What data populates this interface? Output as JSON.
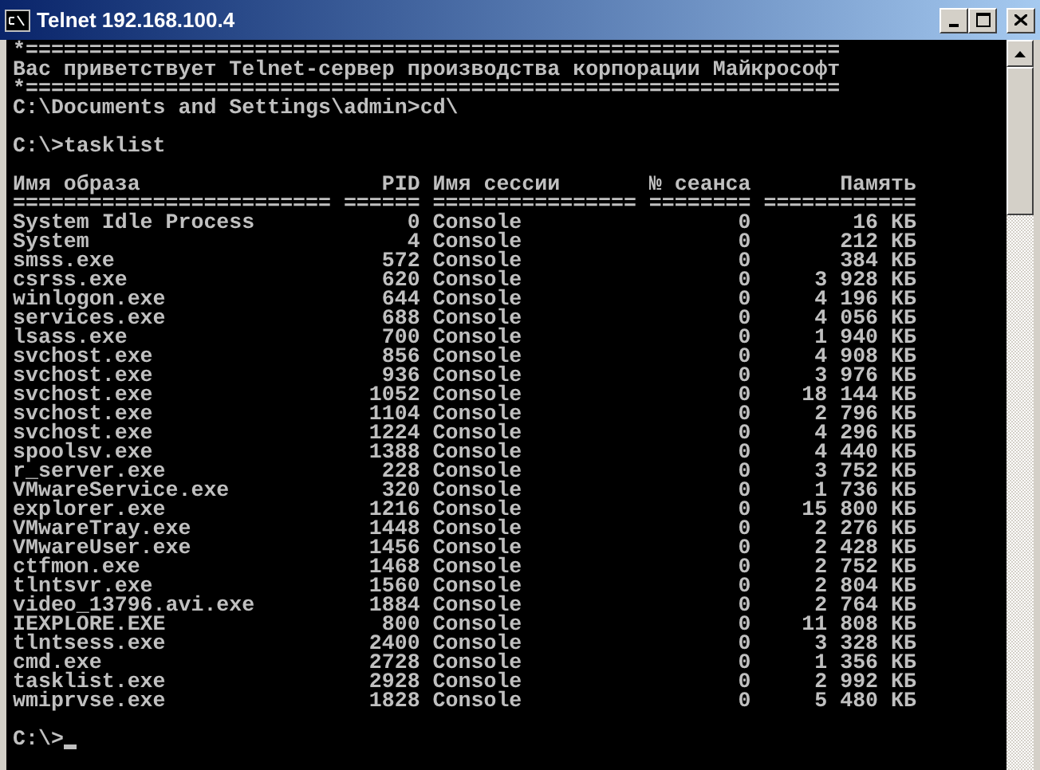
{
  "window": {
    "title": "Telnet 192.168.100.4"
  },
  "console": {
    "lines": [
      {
        "kind": "text",
        "text": "*================================================================"
      },
      {
        "kind": "text",
        "text": "Вас приветствует Telnet-сервер производства корпорации Майкрософт"
      },
      {
        "kind": "text",
        "text": "*================================================================"
      },
      {
        "kind": "text",
        "text": "C:\\Documents and Settings\\admin>cd\\"
      },
      {
        "kind": "blank"
      },
      {
        "kind": "text",
        "text": "C:\\>tasklist"
      },
      {
        "kind": "blank"
      }
    ],
    "table": {
      "columns": [
        {
          "label": "Имя образа",
          "separator": "=========================",
          "kind": "text"
        },
        {
          "label": "PID",
          "separator": "======",
          "kind": "number"
        },
        {
          "label": "Имя сессии",
          "separator": "================",
          "kind": "text"
        },
        {
          "label": "№ сеанса",
          "separator": "========",
          "kind": "number"
        },
        {
          "label": "Память",
          "separator": "============",
          "kind": "number"
        }
      ],
      "rows": [
        [
          "System Idle Process",
          "0",
          "Console",
          "0",
          "16 КБ"
        ],
        [
          "System",
          "4",
          "Console",
          "0",
          "212 КБ"
        ],
        [
          "smss.exe",
          "572",
          "Console",
          "0",
          "384 КБ"
        ],
        [
          "csrss.exe",
          "620",
          "Console",
          "0",
          "3 928 КБ"
        ],
        [
          "winlogon.exe",
          "644",
          "Console",
          "0",
          "4 196 КБ"
        ],
        [
          "services.exe",
          "688",
          "Console",
          "0",
          "4 056 КБ"
        ],
        [
          "lsass.exe",
          "700",
          "Console",
          "0",
          "1 940 КБ"
        ],
        [
          "svchost.exe",
          "856",
          "Console",
          "0",
          "4 908 КБ"
        ],
        [
          "svchost.exe",
          "936",
          "Console",
          "0",
          "3 976 КБ"
        ],
        [
          "svchost.exe",
          "1052",
          "Console",
          "0",
          "18 144 КБ"
        ],
        [
          "svchost.exe",
          "1104",
          "Console",
          "0",
          "2 796 КБ"
        ],
        [
          "svchost.exe",
          "1224",
          "Console",
          "0",
          "4 296 КБ"
        ],
        [
          "spoolsv.exe",
          "1388",
          "Console",
          "0",
          "4 440 КБ"
        ],
        [
          "r_server.exe",
          "228",
          "Console",
          "0",
          "3 752 КБ"
        ],
        [
          "VMwareService.exe",
          "320",
          "Console",
          "0",
          "1 736 КБ"
        ],
        [
          "explorer.exe",
          "1216",
          "Console",
          "0",
          "15 800 КБ"
        ],
        [
          "VMwareTray.exe",
          "1448",
          "Console",
          "0",
          "2 276 КБ"
        ],
        [
          "VMwareUser.exe",
          "1456",
          "Console",
          "0",
          "2 428 КБ"
        ],
        [
          "ctfmon.exe",
          "1468",
          "Console",
          "0",
          "2 752 КБ"
        ],
        [
          "tlntsvr.exe",
          "1560",
          "Console",
          "0",
          "2 804 КБ"
        ],
        [
          "video_13796.avi.exe",
          "1884",
          "Console",
          "0",
          "2 764 КБ"
        ],
        [
          "IEXPLORE.EXE",
          "800",
          "Console",
          "0",
          "11 808 КБ"
        ],
        [
          "tlntsess.exe",
          "2400",
          "Console",
          "0",
          "3 328 КБ"
        ],
        [
          "cmd.exe",
          "2728",
          "Console",
          "0",
          "1 356 КБ"
        ],
        [
          "tasklist.exe",
          "2928",
          "Console",
          "0",
          "2 992 КБ"
        ],
        [
          "wmiprvse.exe",
          "1828",
          "Console",
          "0",
          "5 480 КБ"
        ]
      ]
    },
    "prompt": {
      "text": "C:\\>",
      "cursor": true
    }
  }
}
